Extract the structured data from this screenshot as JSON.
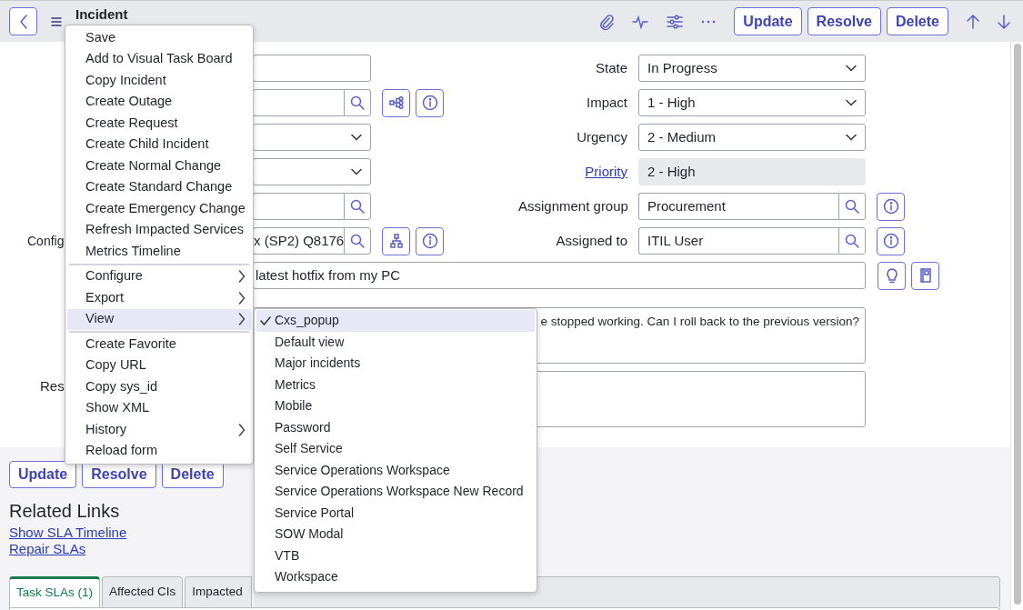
{
  "header": {
    "title": "Incident",
    "buttons": [
      "Update",
      "Resolve",
      "Delete"
    ]
  },
  "form": {
    "rows": [
      {
        "left": {
          "kind": "text"
        },
        "right": {
          "label": "State",
          "kind": "select",
          "value": "In Progress",
          "label_link": false
        }
      },
      {
        "left": {
          "kind": "service_lookup"
        },
        "right": {
          "label": "Impact",
          "kind": "select",
          "value": "1 - High",
          "label_link": false
        }
      },
      {
        "left": {
          "kind": "select"
        },
        "right": {
          "label": "Urgency",
          "kind": "select",
          "value": "2 - Medium",
          "label_link": false
        }
      },
      {
        "left": {
          "kind": "select"
        },
        "right": {
          "label": "Priority",
          "kind": "readonly",
          "value": "2 - High",
          "label_link": true
        }
      },
      {
        "left": {
          "kind": "lookup"
        },
        "right": {
          "label": "Assignment group",
          "kind": "lookup",
          "value": "Procurement",
          "label_link": false
        }
      },
      {
        "left": {
          "kind": "ci_lookup",
          "label": "Config",
          "value": "x (SP2) Q8176"
        },
        "right": {
          "label": "Assigned to",
          "kind": "lookup",
          "value": "ITIL User",
          "label_link": false
        }
      }
    ],
    "short_description": {
      "value": "latest hotfix from my PC"
    },
    "description": {
      "value": "e stopped working. Can I roll back to the previous version?"
    },
    "resolution": {
      "label": "Res"
    }
  },
  "bottom_buttons": [
    "Update",
    "Resolve",
    "Delete"
  ],
  "related_links": {
    "title": "Related Links",
    "links": [
      "Show SLA Timeline",
      "Repair SLAs"
    ]
  },
  "tabs": [
    {
      "label": "Task SLAs (1)",
      "selected": true
    },
    {
      "label": "Affected CIs",
      "selected": false
    },
    {
      "label": "Impacted",
      "selected": false
    }
  ],
  "context_menu": {
    "items": [
      {
        "kind": "item",
        "label": "Save",
        "submenu": false,
        "selected": false
      },
      {
        "kind": "item",
        "label": "Add to Visual Task Board",
        "submenu": false,
        "selected": false
      },
      {
        "kind": "item",
        "label": "Copy Incident",
        "submenu": false,
        "selected": false
      },
      {
        "kind": "item",
        "label": "Create Outage",
        "submenu": false,
        "selected": false
      },
      {
        "kind": "item",
        "label": "Create Request",
        "submenu": false,
        "selected": false
      },
      {
        "kind": "item",
        "label": "Create Child Incident",
        "submenu": false,
        "selected": false
      },
      {
        "kind": "item",
        "label": "Create Normal Change",
        "submenu": false,
        "selected": false
      },
      {
        "kind": "item",
        "label": "Create Standard Change",
        "submenu": false,
        "selected": false
      },
      {
        "kind": "item",
        "label": "Create Emergency Change",
        "submenu": false,
        "selected": false
      },
      {
        "kind": "item",
        "label": "Refresh Impacted Services",
        "submenu": false,
        "selected": false
      },
      {
        "kind": "item",
        "label": "Metrics Timeline",
        "submenu": false,
        "selected": false
      },
      {
        "kind": "separator"
      },
      {
        "kind": "item",
        "label": "Configure",
        "submenu": true,
        "selected": false
      },
      {
        "kind": "item",
        "label": "Export",
        "submenu": true,
        "selected": false
      },
      {
        "kind": "item",
        "label": "View",
        "submenu": true,
        "selected": true
      },
      {
        "kind": "separator"
      },
      {
        "kind": "item",
        "label": "Create Favorite",
        "submenu": false,
        "selected": false
      },
      {
        "kind": "item",
        "label": "Copy URL",
        "submenu": false,
        "selected": false
      },
      {
        "kind": "item",
        "label": "Copy sys_id",
        "submenu": false,
        "selected": false
      },
      {
        "kind": "item",
        "label": "Show XML",
        "submenu": false,
        "selected": false
      },
      {
        "kind": "item",
        "label": "History",
        "submenu": true,
        "selected": false
      },
      {
        "kind": "item",
        "label": "Reload form",
        "submenu": false,
        "selected": false
      }
    ]
  },
  "view_menu": {
    "items": [
      {
        "label": "Cxs_popup",
        "checked": true,
        "selected": true
      },
      {
        "label": "Default view",
        "checked": false,
        "selected": false
      },
      {
        "label": "Major incidents",
        "checked": false,
        "selected": false
      },
      {
        "label": "Metrics",
        "checked": false,
        "selected": false
      },
      {
        "label": "Mobile",
        "checked": false,
        "selected": false
      },
      {
        "label": "Password",
        "checked": false,
        "selected": false
      },
      {
        "label": "Self Service",
        "checked": false,
        "selected": false
      },
      {
        "label": "Service Operations Workspace",
        "checked": false,
        "selected": false
      },
      {
        "label": "Service Operations Workspace New Record",
        "checked": false,
        "selected": false
      },
      {
        "label": "Service Portal",
        "checked": false,
        "selected": false
      },
      {
        "label": "SOW Modal",
        "checked": false,
        "selected": false
      },
      {
        "label": "VTB",
        "checked": false,
        "selected": false
      },
      {
        "label": "Workspace",
        "checked": false,
        "selected": false
      }
    ]
  }
}
